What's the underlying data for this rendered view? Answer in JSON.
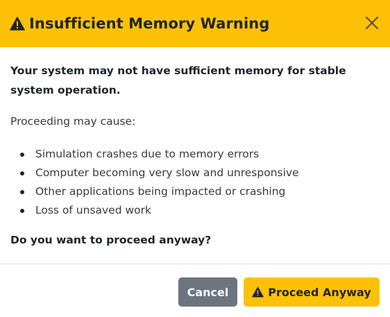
{
  "dialog": {
    "title": "Insufficient Memory Warning",
    "title_icon": "warning-triangle-icon",
    "close_icon": "close-icon",
    "lead": "Your system may not have sufficient memory for stable system operation.",
    "intro": "Proceeding may cause:",
    "consequences": [
      "Simulation crashes due to memory errors",
      "Computer becoming very slow and unresponsive",
      "Other applications being impacted or crashing",
      "Loss of unsaved work"
    ],
    "question": "Do you want to proceed anyway?"
  },
  "footer": {
    "cancel_label": "Cancel",
    "proceed_label": "Proceed Anyway",
    "proceed_icon": "warning-triangle-icon"
  },
  "colors": {
    "header_bg": "#ffc107",
    "cancel_bg": "#6c757d",
    "proceed_bg": "#ffc107",
    "text": "#212529"
  }
}
